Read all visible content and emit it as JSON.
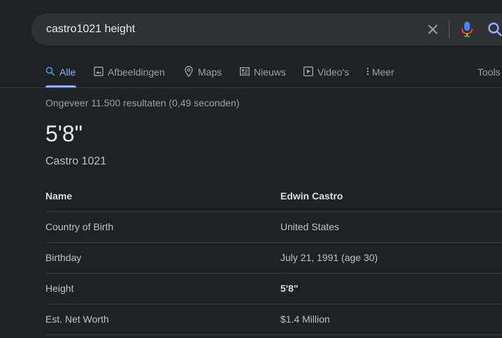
{
  "search": {
    "query": "castro1021 height"
  },
  "tabs": [
    {
      "label": "Alle",
      "icon": "search-icon"
    },
    {
      "label": "Afbeeldingen",
      "icon": "image-icon"
    },
    {
      "label": "Maps",
      "icon": "map-pin-icon"
    },
    {
      "label": "Nieuws",
      "icon": "news-icon"
    },
    {
      "label": "Video's",
      "icon": "video-icon"
    },
    {
      "label": "Meer",
      "icon": "more-vert-icon"
    },
    {
      "label": "Tools",
      "icon": ""
    }
  ],
  "result_stats": "Ongeveer 11.500 resultaten (0,49 seconden)",
  "answer": {
    "value": "5'8\"",
    "subject": "Castro 1021"
  },
  "info_table": [
    {
      "key": "Name",
      "value": "Edwin Castro"
    },
    {
      "key": "Country of Birth",
      "value": "United States"
    },
    {
      "key": "Birthday",
      "value": "July 21, 1991 (age 30)"
    },
    {
      "key": "Height",
      "value": "5'8\""
    },
    {
      "key": "Est. Net Worth",
      "value": "$1.4 Million"
    }
  ],
  "colors": {
    "background": "#202124",
    "search_bar": "#303134",
    "accent": "#8ab4f8",
    "text": "#bdc1c6",
    "muted": "#9aa0a6"
  }
}
